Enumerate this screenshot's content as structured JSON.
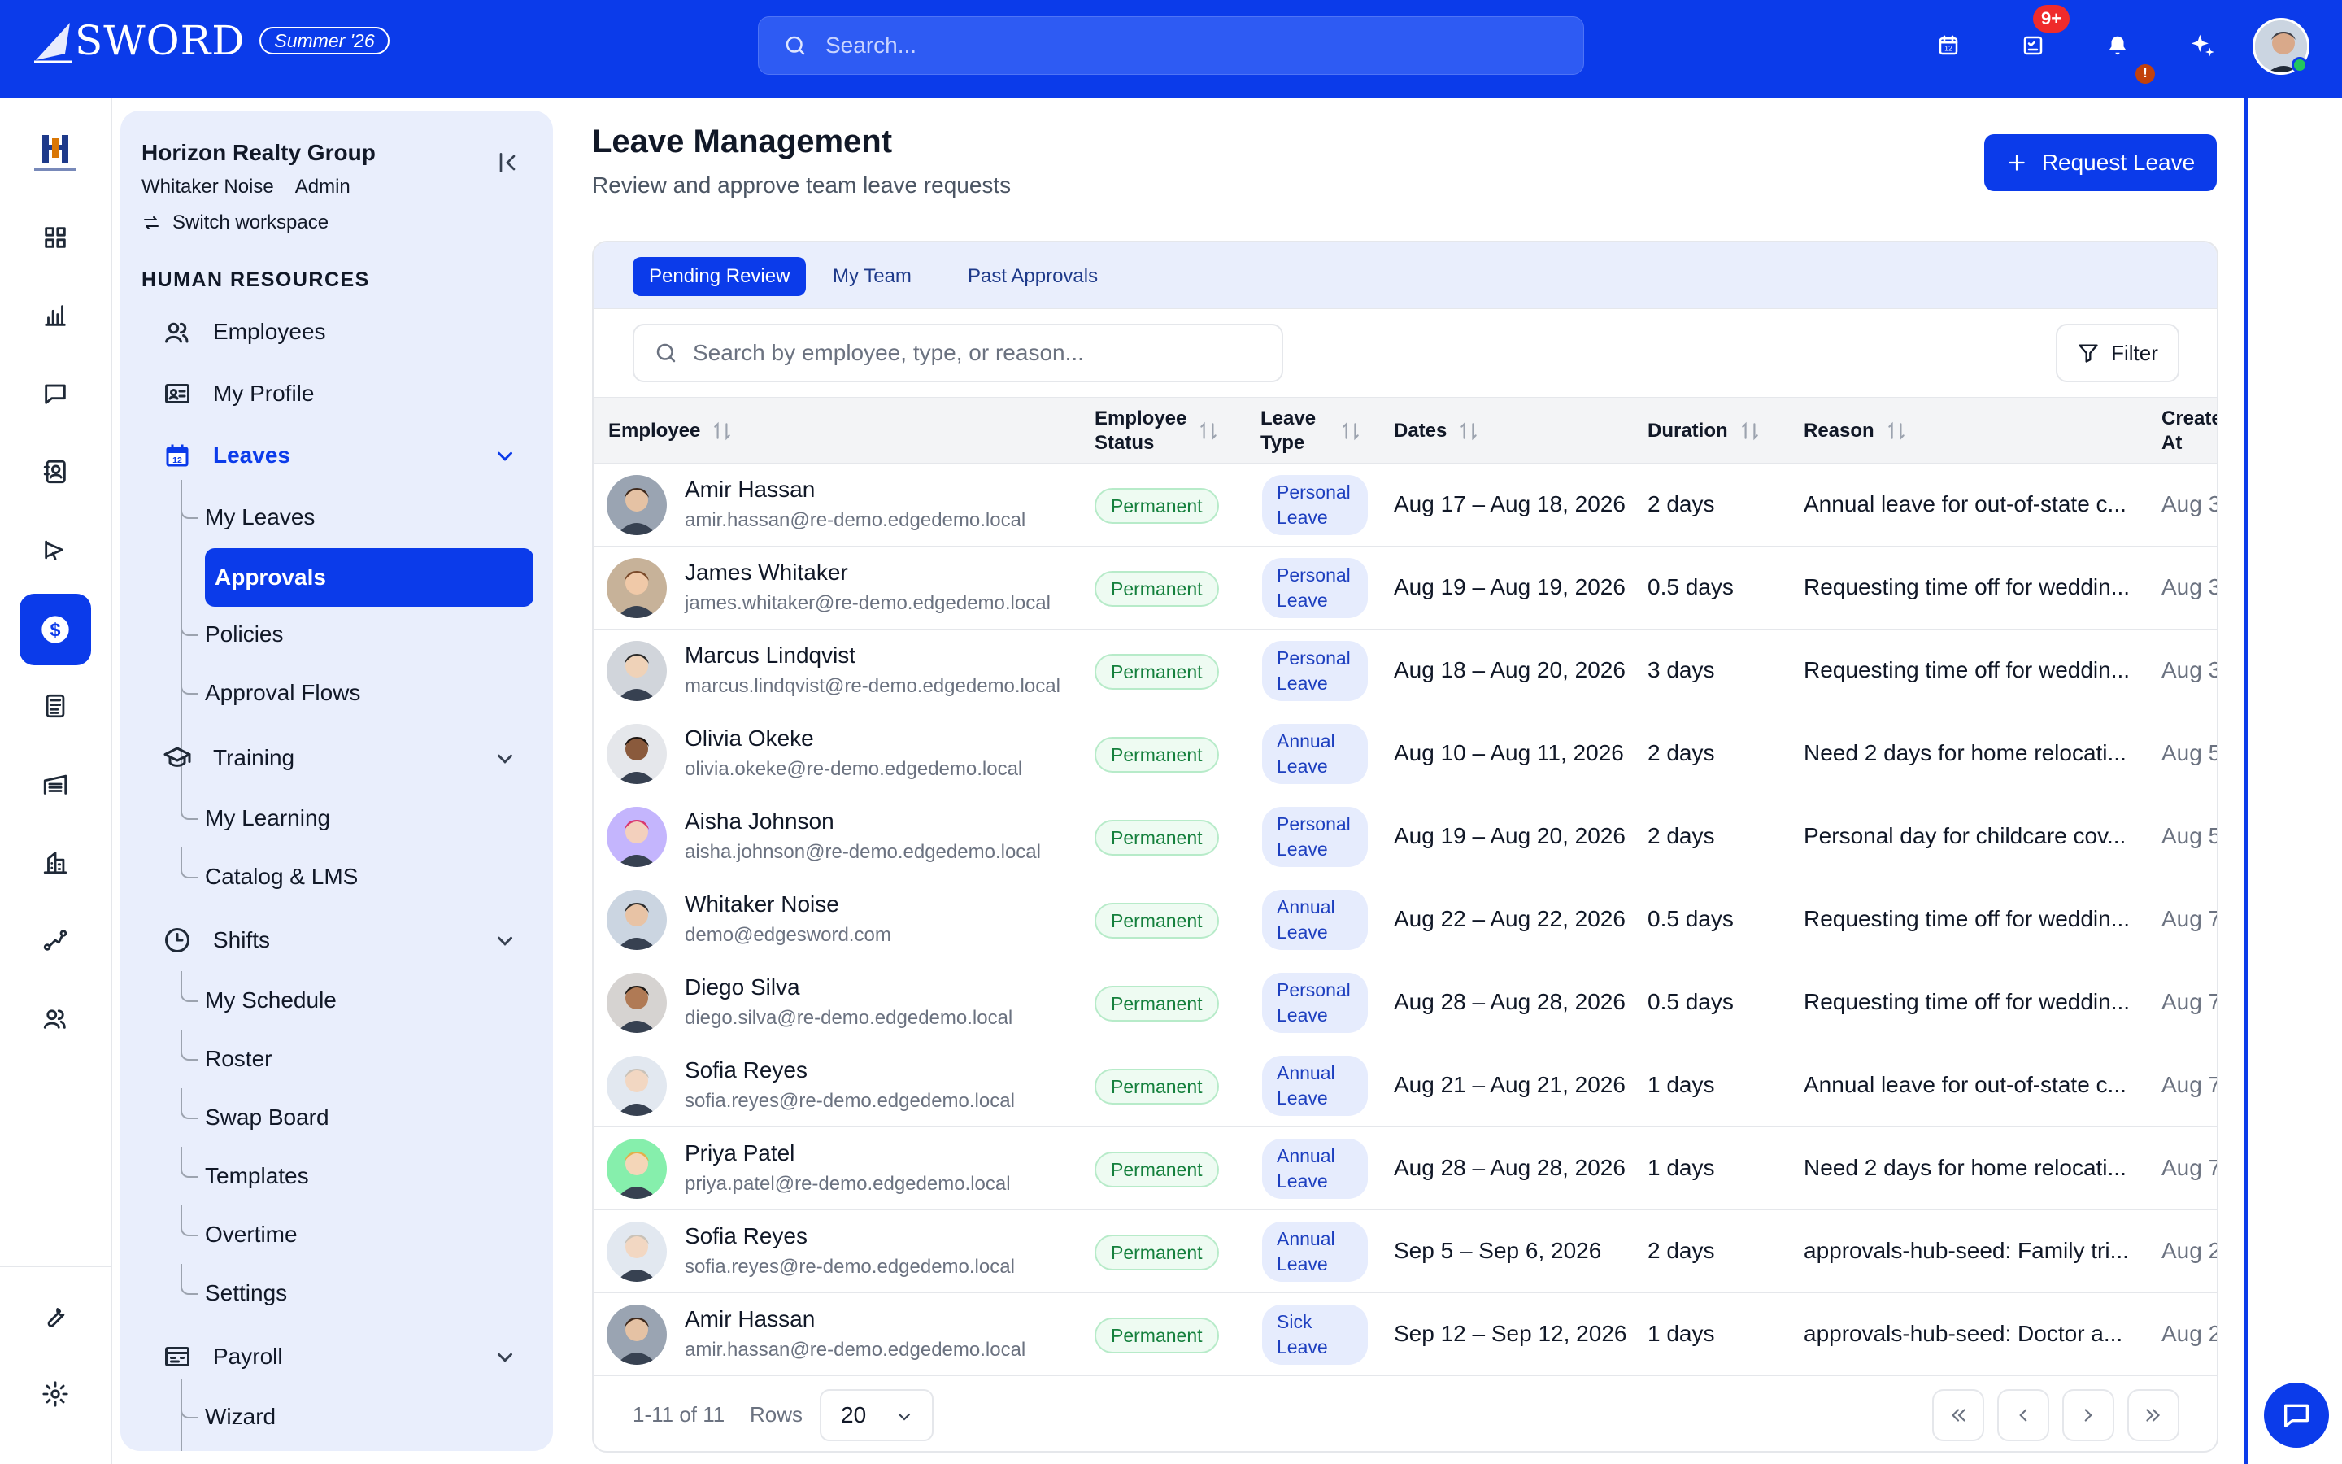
{
  "brand": {
    "name": "SWORD",
    "season": "Summer '26"
  },
  "search": {
    "placeholder": "Search..."
  },
  "notifications": {
    "badge": "9+",
    "alert": "!"
  },
  "colors": {
    "primary": "#0b3bea",
    "sidebar_bg": "#e9eefc",
    "status_green": "#15803d"
  },
  "rail": {
    "items": [
      "dashboard-icon",
      "chart-icon",
      "message-icon",
      "contacts-icon",
      "megaphone-icon",
      "finance-icon",
      "calculator-icon",
      "warehouse-icon",
      "building-icon",
      "route-icon",
      "users-icon"
    ],
    "bottom": [
      "wrench-icon",
      "gear-icon"
    ]
  },
  "sidebar": {
    "org": "Horizon Realty Group",
    "user": "Whitaker Noise",
    "role": "Admin",
    "switch": "Switch workspace",
    "section": "HUMAN RESOURCES",
    "employees": "Employees",
    "profile": "My Profile",
    "leaves": "Leaves",
    "leaves_sub": [
      "My Leaves",
      "Approvals",
      "Policies",
      "Approval Flows"
    ],
    "training": "Training",
    "training_sub": [
      "My Learning",
      "Catalog & LMS"
    ],
    "shifts": "Shifts",
    "shifts_sub": [
      "My Schedule",
      "Roster",
      "Swap Board",
      "Templates",
      "Overtime",
      "Settings"
    ],
    "payroll": "Payroll",
    "payroll_sub": [
      "Wizard"
    ]
  },
  "main": {
    "title": "Leave Management",
    "subtitle": "Review and approve team leave requests",
    "request_button": "Request Leave",
    "tabs": [
      "Pending Review",
      "My Team",
      "Past Approvals"
    ],
    "search_placeholder": "Search by employee, type, or reason...",
    "filter": "Filter"
  },
  "table": {
    "headers": {
      "employee": "Employee",
      "status_1": "Employee",
      "status_2": "Status",
      "type_1": "Leave",
      "type_2": "Type",
      "dates": "Dates",
      "duration": "Duration",
      "reason": "Reason",
      "created_1": "Create",
      "created_2": "At"
    },
    "rows": [
      {
        "name": "Amir Hassan",
        "email": "amir.hassan@re-demo.edgedemo.local",
        "status": "Permanent",
        "type1": "Personal",
        "type2": "Leave",
        "dates": "Aug 17 – Aug 18, 2026",
        "duration": "2 days",
        "reason": "Annual leave for out-of-state c...",
        "created": "Aug 3"
      },
      {
        "name": "James Whitaker",
        "email": "james.whitaker@re-demo.edgedemo.local",
        "status": "Permanent",
        "type1": "Personal",
        "type2": "Leave",
        "dates": "Aug 19 – Aug 19, 2026",
        "duration": "0.5 days",
        "reason": "Requesting time off for weddin...",
        "created": "Aug 3"
      },
      {
        "name": "Marcus Lindqvist",
        "email": "marcus.lindqvist@re-demo.edgedemo.local",
        "status": "Permanent",
        "type1": "Personal",
        "type2": "Leave",
        "dates": "Aug 18 – Aug 20, 2026",
        "duration": "3 days",
        "reason": "Requesting time off for weddin...",
        "created": "Aug 3"
      },
      {
        "name": "Olivia Okeke",
        "email": "olivia.okeke@re-demo.edgedemo.local",
        "status": "Permanent",
        "type1": "Annual",
        "type2": "Leave",
        "dates": "Aug 10 – Aug 11, 2026",
        "duration": "2 days",
        "reason": "Need 2 days for home relocati...",
        "created": "Aug 5"
      },
      {
        "name": "Aisha Johnson",
        "email": "aisha.johnson@re-demo.edgedemo.local",
        "status": "Permanent",
        "type1": "Personal",
        "type2": "Leave",
        "dates": "Aug 19 – Aug 20, 2026",
        "duration": "2 days",
        "reason": "Personal day for childcare cov...",
        "created": "Aug 5"
      },
      {
        "name": "Whitaker Noise",
        "email": "demo@edgesword.com",
        "status": "Permanent",
        "type1": "Annual",
        "type2": "Leave",
        "dates": "Aug 22 – Aug 22, 2026",
        "duration": "0.5 days",
        "reason": "Requesting time off for weddin...",
        "created": "Aug 7"
      },
      {
        "name": "Diego Silva",
        "email": "diego.silva@re-demo.edgedemo.local",
        "status": "Permanent",
        "type1": "Personal",
        "type2": "Leave",
        "dates": "Aug 28 – Aug 28, 2026",
        "duration": "0.5 days",
        "reason": "Requesting time off for weddin...",
        "created": "Aug 7"
      },
      {
        "name": "Sofia Reyes",
        "email": "sofia.reyes@re-demo.edgedemo.local",
        "status": "Permanent",
        "type1": "Annual",
        "type2": "Leave",
        "dates": "Aug 21 – Aug 21, 2026",
        "duration": "1 days",
        "reason": "Annual leave for out-of-state c...",
        "created": "Aug 7"
      },
      {
        "name": "Priya Patel",
        "email": "priya.patel@re-demo.edgedemo.local",
        "status": "Permanent",
        "type1": "Annual",
        "type2": "Leave",
        "dates": "Aug 28 – Aug 28, 2026",
        "duration": "1 days",
        "reason": "Need 2 days for home relocati...",
        "created": "Aug 7"
      },
      {
        "name": "Sofia Reyes",
        "email": "sofia.reyes@re-demo.edgedemo.local",
        "status": "Permanent",
        "type1": "Annual",
        "type2": "Leave",
        "dates": "Sep 5 – Sep 6, 2026",
        "duration": "2 days",
        "reason": "approvals-hub-seed: Family tri...",
        "created": "Aug 2"
      },
      {
        "name": "Amir Hassan",
        "email": "amir.hassan@re-demo.edgedemo.local",
        "status": "Permanent",
        "type1": "Sick",
        "type2": "Leave",
        "dates": "Sep 12 – Sep 12, 2026",
        "duration": "1 days",
        "reason": "approvals-hub-seed: Doctor a...",
        "created": "Aug 2"
      }
    ]
  },
  "pagination": {
    "count": "1-11 of 11",
    "rows_label": "Rows",
    "rows_value": "20"
  }
}
